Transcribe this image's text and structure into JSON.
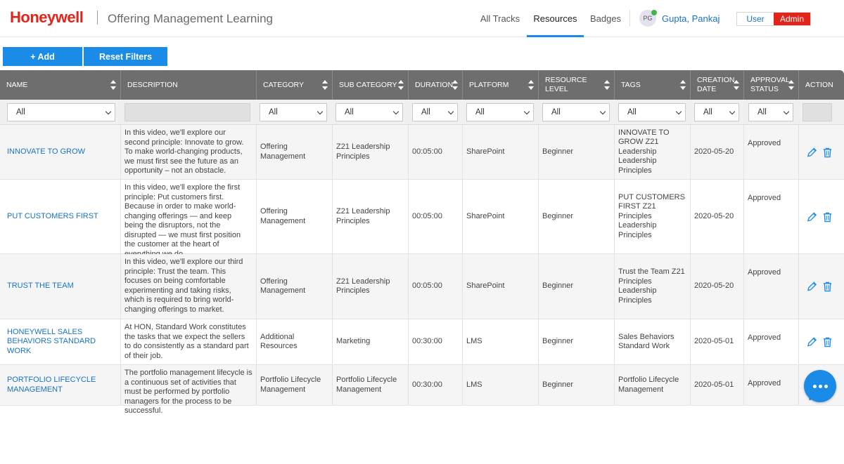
{
  "header": {
    "logo": "Honeywell",
    "title": "Offering Management Learning",
    "nav": [
      "All Tracks",
      "Resources",
      "Badges"
    ],
    "active_nav": "Resources",
    "user_initials": "PG",
    "user_name": "Gupta, Pankaj",
    "role_user": "User",
    "role_admin": "Admin"
  },
  "toolbar": {
    "add_label": "+ Add",
    "reset_label": "Reset Filters"
  },
  "table": {
    "columns": [
      {
        "label": "NAME",
        "sortable": true
      },
      {
        "label": "DESCRIPTION",
        "sortable": false
      },
      {
        "label": "CATEGORY",
        "sortable": true
      },
      {
        "label": "SUB CATEGORY",
        "sortable": true
      },
      {
        "label": "DURATION",
        "sortable": true
      },
      {
        "label": "PLATFORM",
        "sortable": true
      },
      {
        "label": "RESOURCE LEVEL",
        "sortable": true
      },
      {
        "label": "TAGS",
        "sortable": true
      },
      {
        "label": "CREATION DATE",
        "sortable": true
      },
      {
        "label": "APPROVAL STATUS",
        "sortable": true
      },
      {
        "label": "ACTION",
        "sortable": false
      }
    ],
    "filter_value": "All",
    "rows": [
      {
        "name": "INNOVATE TO GROW",
        "description": "In this video, we'll explore our second principle: Innovate to grow. To make world-changing products, we must first see the future as an opportunity – not an obstacle.",
        "category": "Offering Management",
        "sub_category": "Z21 Leadership Principles",
        "duration": "00:05:00",
        "platform": "SharePoint",
        "level": "Beginner",
        "tags": "INNOVATE TO GROW Z21 Leadership Leadership Principles",
        "date": "2020-05-20",
        "status": "Approved"
      },
      {
        "name": "PUT CUSTOMERS FIRST",
        "description": "In this video, we'll explore the first principle: Put customers first. Because in order to make world-changing offerings — and keep being the disruptors, not the disrupted — we must first position the customer at the heart of everything we do.",
        "category": "Offering Management",
        "sub_category": "Z21 Leadership Principles",
        "duration": "00:05:00",
        "platform": "SharePoint",
        "level": "Beginner",
        "tags": "PUT CUSTOMERS FIRST Z21 Principles Leadership Principles",
        "date": "2020-05-20",
        "status": "Approved"
      },
      {
        "name": "TRUST THE TEAM",
        "description": "In this video, we'll explore our third principle: Trust the team. This focuses on being comfortable experimenting and taking risks, which is required to bring world-changing offerings to market.",
        "category": "Offering Management",
        "sub_category": "Z21 Leadership Principles",
        "duration": "00:05:00",
        "platform": "SharePoint",
        "level": "Beginner",
        "tags": "Trust the Team Z21 Principles Leadership Principles",
        "date": "2020-05-20",
        "status": "Approved"
      },
      {
        "name": "HONEYWELL SALES BEHAVIORS STANDARD WORK",
        "description": "At HON, Standard Work constitutes the tasks that we expect the sellers to do consistently as a standard part of their job.",
        "category": "Additional Resources",
        "sub_category": "Marketing",
        "duration": "00:30:00",
        "platform": "LMS",
        "level": "Beginner",
        "tags": "Sales Behaviors Standard Work",
        "date": "2020-05-01",
        "status": "Approved"
      },
      {
        "name": "PORTFOLIO LIFECYCLE MANAGEMENT",
        "description": "The portfolio management lifecycle is a continuous set of activities that must be performed by portfolio managers for the process to be successful.",
        "category": "Portfolio Lifecycle Management",
        "sub_category": "Portfolio Lifecycle Management",
        "duration": "00:30:00",
        "platform": "LMS",
        "level": "Beginner",
        "tags": "Portfolio Lifecycle Management",
        "date": "2020-05-01",
        "status": "Approved"
      }
    ]
  },
  "icons": {
    "edit": "pencil-icon",
    "delete": "trash-icon",
    "chat": "chat-bubble-icon"
  },
  "colors": {
    "brand_red": "#e1251b",
    "accent_blue": "#1b8be8",
    "link_blue": "#1a73c4",
    "header_gray": "#6e6e6e"
  }
}
